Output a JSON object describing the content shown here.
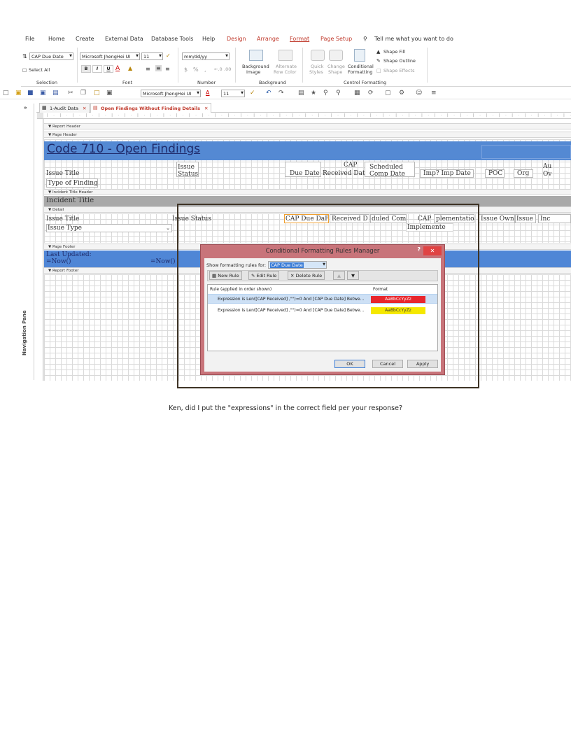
{
  "menu": {
    "items": [
      "File",
      "Home",
      "Create",
      "External Data",
      "Database Tools",
      "Help",
      "Design",
      "Arrange",
      "Format",
      "Page Setup"
    ],
    "tell_me": "Tell me what you want to do"
  },
  "ribbon": {
    "selection": {
      "object_combo": "CAP Due Date",
      "select_all": "Select All",
      "group_label": "Selection"
    },
    "font": {
      "font_name": "Microsoft JhengHei UI",
      "font_size": "11",
      "bold": "B",
      "italic": "I",
      "underline": "U",
      "group_label": "Font"
    },
    "number": {
      "format": "mm/dd/yy",
      "currency": "$",
      "percent": "%",
      "comma": ",",
      "group_label": "Number"
    },
    "background": {
      "background_image": "Background",
      "background_image_2": "Image",
      "alternate_row": "Alternate",
      "alternate_row_2": "Row Color",
      "group_label": "Background"
    },
    "control_formatting": {
      "quick_styles": "Quick",
      "quick_styles_2": "Styles",
      "change_shape": "Change",
      "change_shape_2": "Shape",
      "conditional": "Conditional",
      "conditional_2": "Formatting",
      "shape_fill": "Shape Fill",
      "shape_outline": "Shape Outline",
      "shape_effects": "Shape Effects",
      "group_label": "Control Formatting"
    }
  },
  "qat": {
    "font_name": "Microsoft JhengHei UI",
    "font_size": "11"
  },
  "tabs": [
    {
      "label": "1-Audit Data"
    },
    {
      "label": "Open Findings Without Finding Details"
    }
  ],
  "nav_pane_label": "Navigation Pane",
  "report": {
    "sections": {
      "report_header": "Report Header",
      "page_header": "Page Header",
      "incident_header": "Incident Title Header",
      "detail": "Detail",
      "page_footer": "Page Footer",
      "report_footer": "Report Footer"
    },
    "title": "Code 710 - Open Findings",
    "page_header_labels": {
      "issue_title": "Issue Title",
      "issue_status_1": "Issue",
      "issue_status_2": "Status",
      "type_of_finding": "Type of Finding",
      "due_date": "Due Date",
      "cap_1": "CAP",
      "received_date": "Received Date",
      "scheduled_1": "Scheduled",
      "scheduled_2": "Comp Date",
      "imp": "Imp? Imp Date",
      "poc": "POC",
      "org": "Org",
      "au_1": "Au",
      "au_2": "Ov"
    },
    "incident_title": "Incident Title",
    "detail_fields": {
      "issue_title": "Issue Title",
      "issue_type": "Issue Type",
      "issue_status": "Issue Status",
      "cap_due_date": "CAP Due Da",
      "p": "P",
      "received_d": "Received D",
      "duled_comp": "duled Comp",
      "cap": "CAP",
      "implementation": "plementatio",
      "implemente": "Implemente",
      "issue_own": "Issue Own",
      "issue": "Issue",
      "inc": "Inc"
    },
    "footer": {
      "last_updated": "Last Updated:",
      "now_left": "=Now()",
      "now_right": "=Now()"
    }
  },
  "dialog": {
    "title": "Conditional Formatting Rules Manager",
    "help": "?",
    "show_rules_label": "Show formatting rules for:",
    "show_rules_value": "CAP Due Date",
    "buttons": {
      "new_rule": "New Rule",
      "edit_rule": "Edit Rule",
      "delete_rule": "Delete Rule"
    },
    "columns": {
      "rule": "Rule (applied in order shown)",
      "format": "Format"
    },
    "rules": [
      {
        "text": "Expression is Len([CAP Received] ,\"\")=0 And [CAP Due Date] Betwe...",
        "sample": "AaBbCcYyZz",
        "bg": "#e8262d",
        "fg": "#ffffff"
      },
      {
        "text": "Expression is Len([CAP Received] ,\"\")=0 And [CAP Due Date] Betwe...",
        "sample": "AaBbCcYyZz",
        "bg": "#f5e800",
        "fg": "#333333"
      }
    ],
    "ok": "OK",
    "cancel": "Cancel",
    "apply": "Apply"
  },
  "caption": "Ken, did I put the \"expressions\" in the correct field per your response?",
  "colors": {
    "accent_red": "#c0392b",
    "report_blue": "#4f86d6",
    "dialog_frame": "#c8747a"
  }
}
